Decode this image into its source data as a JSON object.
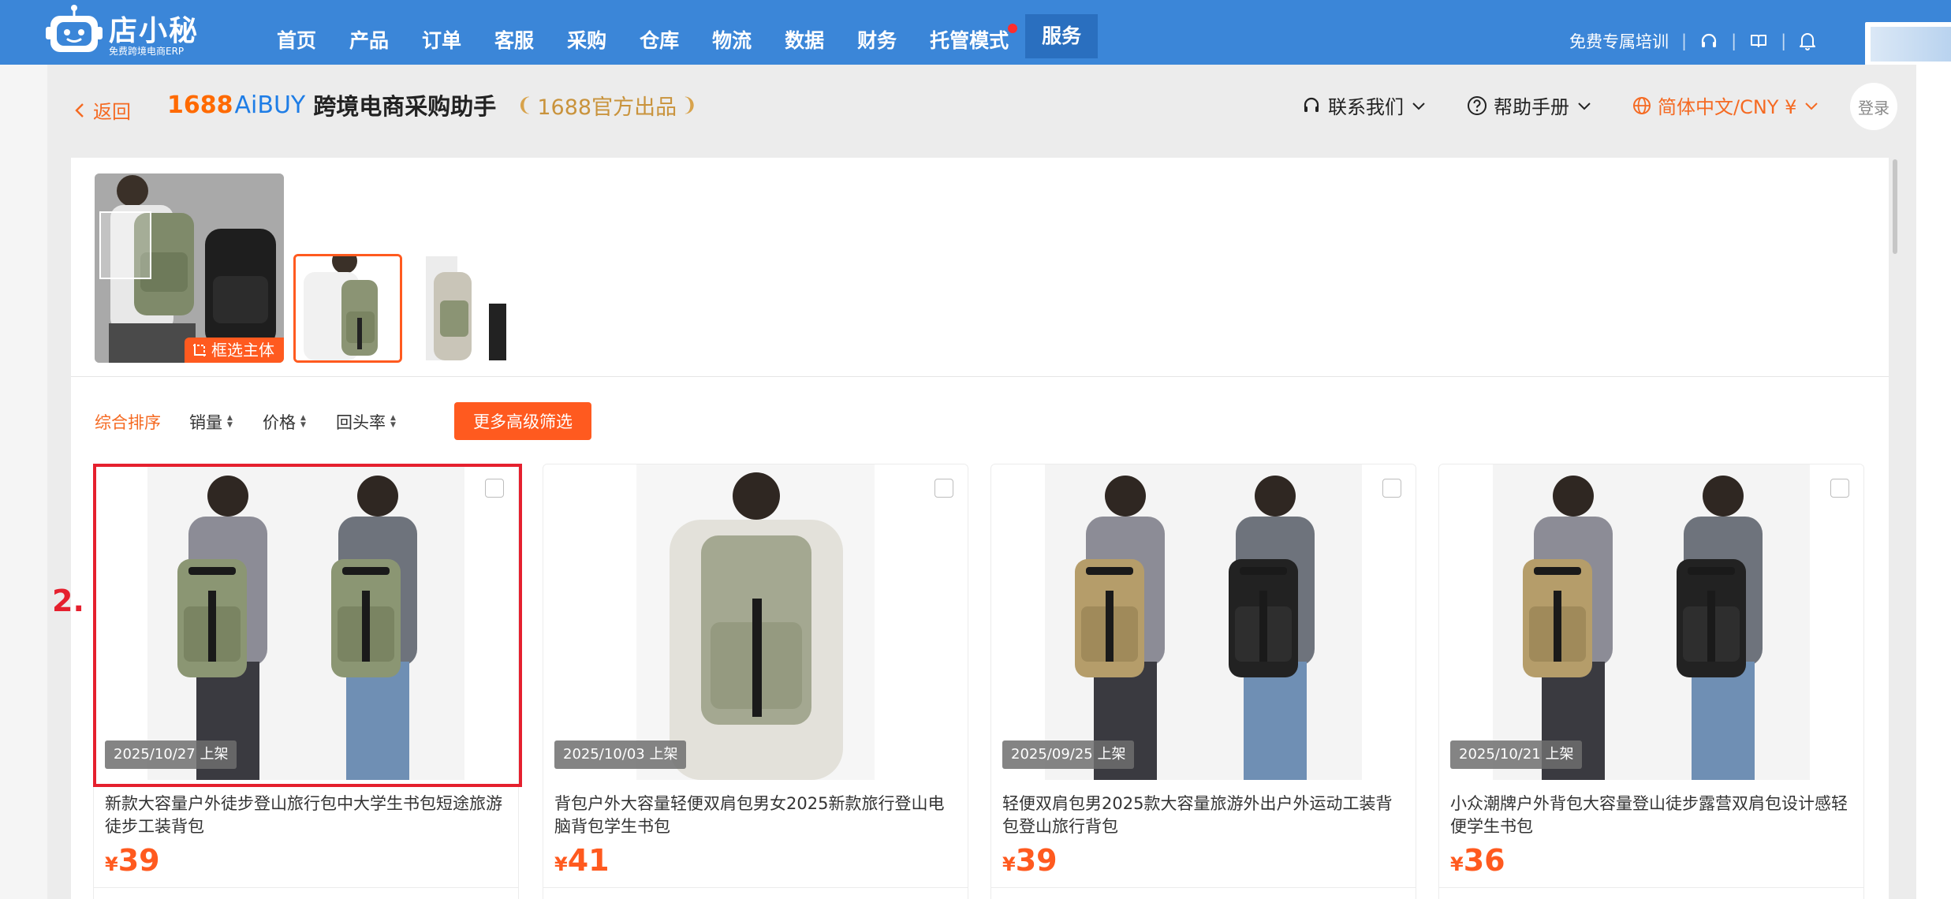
{
  "topbar": {
    "logo_title": "店小秘",
    "logo_subtitle": "免费跨境电商ERP",
    "nav_items": [
      "首页",
      "产品",
      "订单",
      "客服",
      "采购",
      "仓库",
      "物流",
      "数据",
      "财务",
      "托管模式",
      "服务"
    ],
    "active_nav": "服务",
    "dot_nav": "托管模式",
    "training_link": "免费专属培训",
    "accent_color": "#3b86d8"
  },
  "assistant": {
    "back_label": "返回",
    "brand_1688": "1688",
    "brand_aibuy": "AiBUY",
    "title": "跨境电商采购助手",
    "badge": "1688官方出品",
    "contact": "联系我们",
    "help": "帮助手册",
    "language": "简体中文/CNY ¥",
    "login": "登录"
  },
  "image_panel": {
    "select_subject": "框选主体"
  },
  "filters": {
    "sort_default": "综合排序",
    "sales": "销量",
    "price": "价格",
    "repurchase": "回头率",
    "advanced": "更多高级筛选"
  },
  "annotation": {
    "label": "2."
  },
  "products": [
    {
      "date": "2025/10/27 上架",
      "title": "新款大容量户外徒步登山旅行包中大学生书包短途旅游徒步工装背包",
      "currency": "¥",
      "price": "39",
      "variant": "green-couple"
    },
    {
      "date": "2025/10/03 上架",
      "title": "背包户外大容量轻便双肩包男女2025新款旅行登山电脑背包学生书包",
      "currency": "¥",
      "price": "41",
      "variant": "green-single"
    },
    {
      "date": "2025/09/25 上架",
      "title": "轻便双肩包男2025款大容量旅游外出户外运动工装背包登山旅行背包",
      "currency": "¥",
      "price": "39",
      "variant": "khaki-black"
    },
    {
      "date": "2025/10/21 上架",
      "title": "小众潮牌户外背包大容量登山徒步露营双肩包设计感轻便学生书包",
      "currency": "¥",
      "price": "36",
      "variant": "khaki-black"
    }
  ]
}
